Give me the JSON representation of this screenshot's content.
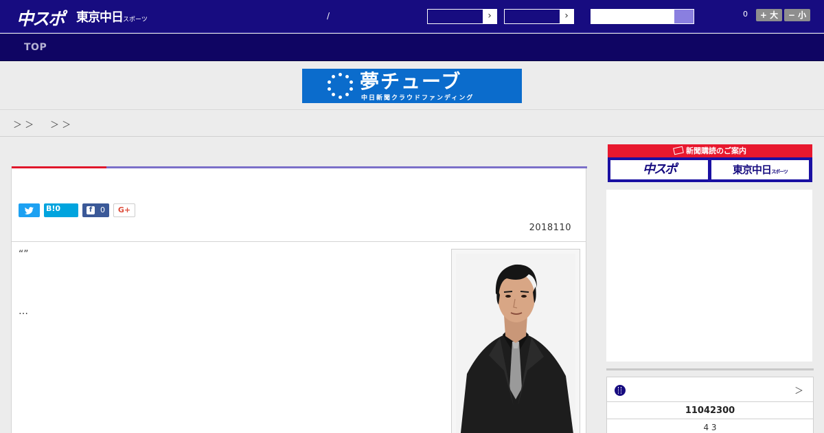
{
  "header": {
    "logo_chunichi": "中スポ",
    "logo_tokyo": "東京中日",
    "logo_tokyo_small": "スポーツ",
    "slash": "/",
    "select1_value": "",
    "select2_value": "",
    "search_placeholder": "",
    "font_count": "0",
    "font_big_label": "+ 大",
    "font_small_label": "− 小"
  },
  "nav": {
    "top_label": "TOP"
  },
  "banner": {
    "title": "夢チューブ",
    "subtitle": "中日新聞クラウドファンディング"
  },
  "breadcrumb": {
    "sep1": "＞ ＞",
    "sep2": "＞ ＞"
  },
  "article": {
    "hatena_label": "B!0",
    "facebook_count": "0",
    "gplus_label": "G+",
    "date": "2018110",
    "body_quote": "“”",
    "body_ellipsis": "…"
  },
  "sidebar": {
    "subscribe_head": "新聞購読のご案内",
    "subscribe_btn1": "中スポ",
    "subscribe_btn2": "東京中日",
    "subscribe_btn2_small": "スポーツ",
    "widget_more": "＞",
    "widget_row1": "11042300",
    "widget_row2": "4  3"
  },
  "colors": {
    "header_bg": "#170c80",
    "nav_bg": "#0f0563",
    "accent_red": "#e0162a",
    "accent_purple": "#7a6fc8",
    "banner_blue": "#0b6ccc"
  }
}
